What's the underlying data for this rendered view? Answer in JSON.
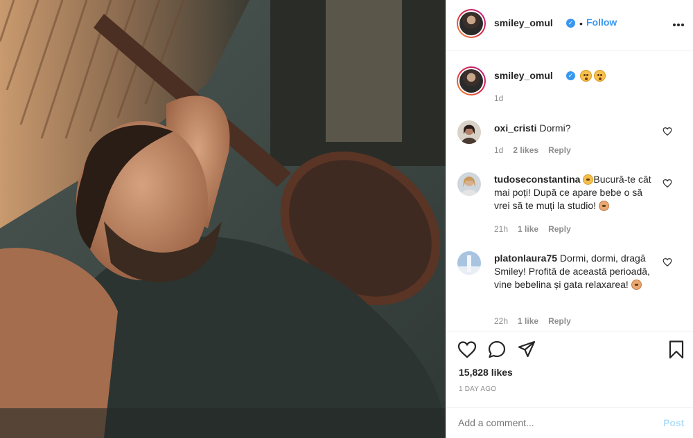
{
  "header": {
    "username": "smiley_omul",
    "separator": "•",
    "follow_label": "Follow",
    "more_icon": "more-horizontal-icon"
  },
  "caption": {
    "username": "smiley_omul",
    "emojis": [
      "sleepy-face-emoji",
      "sleeping-face-emoji"
    ],
    "time": "1d"
  },
  "comments": [
    {
      "username": "oxi_cristi",
      "text": "Dormi?",
      "time": "1d",
      "likes": "2 likes",
      "reply": "Reply"
    },
    {
      "username": "tudoseconstantina",
      "text": "Bucură-te cât mai poți! După ce apare bebe o să vrei să te muți la studio!",
      "time": "21h",
      "likes": "1 like",
      "reply": "Reply"
    },
    {
      "username": "platonlaura75",
      "text": "Dormi, dormi, dragă Smiley! Profită de această perioadă, vine bebelina și gata relaxarea!",
      "time": "22h",
      "likes": "1 like",
      "reply": "Reply"
    }
  ],
  "footer": {
    "likes": "15,828 likes",
    "age": "1 DAY AGO",
    "comment_placeholder": "Add a comment...",
    "post_label": "Post"
  },
  "colors": {
    "link_blue": "#3897f0",
    "muted_text": "#8e8e8e",
    "post_button_disabled": "#b2dffc"
  }
}
